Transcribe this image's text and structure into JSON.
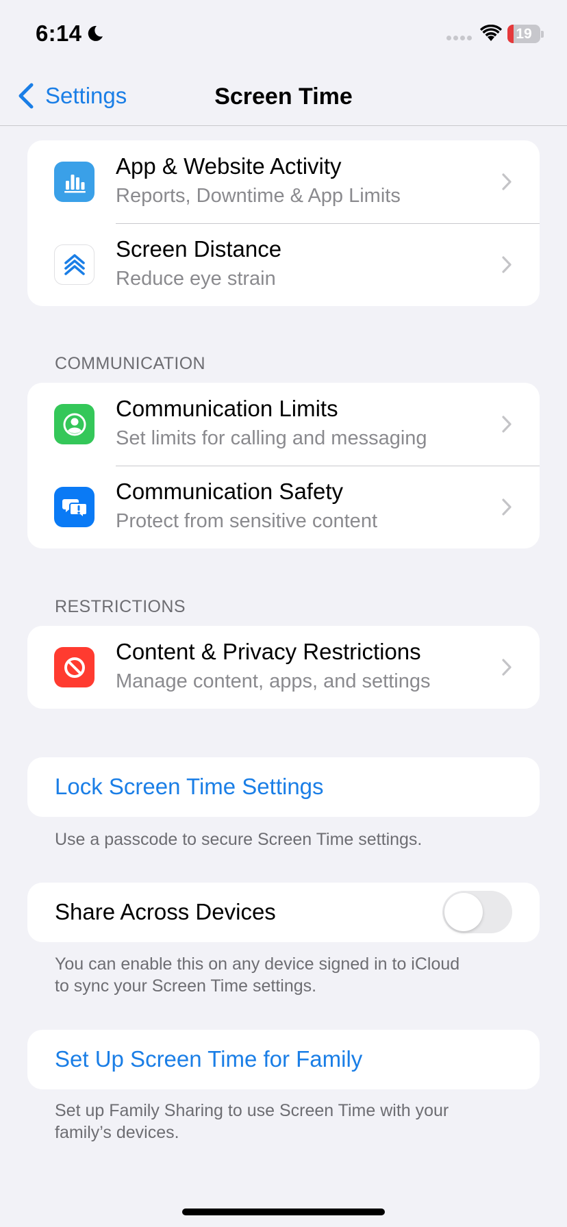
{
  "status_bar": {
    "time": "6:14",
    "battery": "19",
    "battery_level": 0.19
  },
  "nav": {
    "back_label": "Settings",
    "title": "Screen Time"
  },
  "group_activity": {
    "rows": [
      {
        "title": "App & Website Activity",
        "subtitle": "Reports, Downtime & App Limits",
        "icon": "bar-chart-icon",
        "icon_color": "#3aa0e8"
      },
      {
        "title": "Screen Distance",
        "subtitle": "Reduce eye strain",
        "icon": "chevrons-up-icon",
        "icon_color": "#ffffff"
      }
    ]
  },
  "communication": {
    "header": "COMMUNICATION",
    "rows": [
      {
        "title": "Communication Limits",
        "subtitle": "Set limits for calling and messaging",
        "icon": "person-circle-icon",
        "icon_color": "#34c759"
      },
      {
        "title": "Communication Safety",
        "subtitle": "Protect from sensitive content",
        "icon": "chat-bubbles-icon",
        "icon_color": "#0a7af5"
      }
    ]
  },
  "restrictions": {
    "header": "RESTRICTIONS",
    "rows": [
      {
        "title": "Content & Privacy Restrictions",
        "subtitle": "Manage content, apps, and settings",
        "icon": "no-entry-icon",
        "icon_color": "#ff3b30"
      }
    ]
  },
  "lock": {
    "label": "Lock Screen Time Settings",
    "footnote": "Use a passcode to secure Screen Time settings."
  },
  "share": {
    "label": "Share Across Devices",
    "enabled": false,
    "footnote_line1": "You can enable this on any device signed in to iCloud",
    "footnote_line2": "to sync your Screen Time settings."
  },
  "family": {
    "label": "Set Up Screen Time for Family",
    "footnote_line1": "Set up Family Sharing to use Screen Time with your",
    "footnote_line2": "family’s devices."
  },
  "colors": {
    "accent": "#1a7ee6",
    "background": "#f2f2f7",
    "toggle_off": "#e9e9eb"
  }
}
